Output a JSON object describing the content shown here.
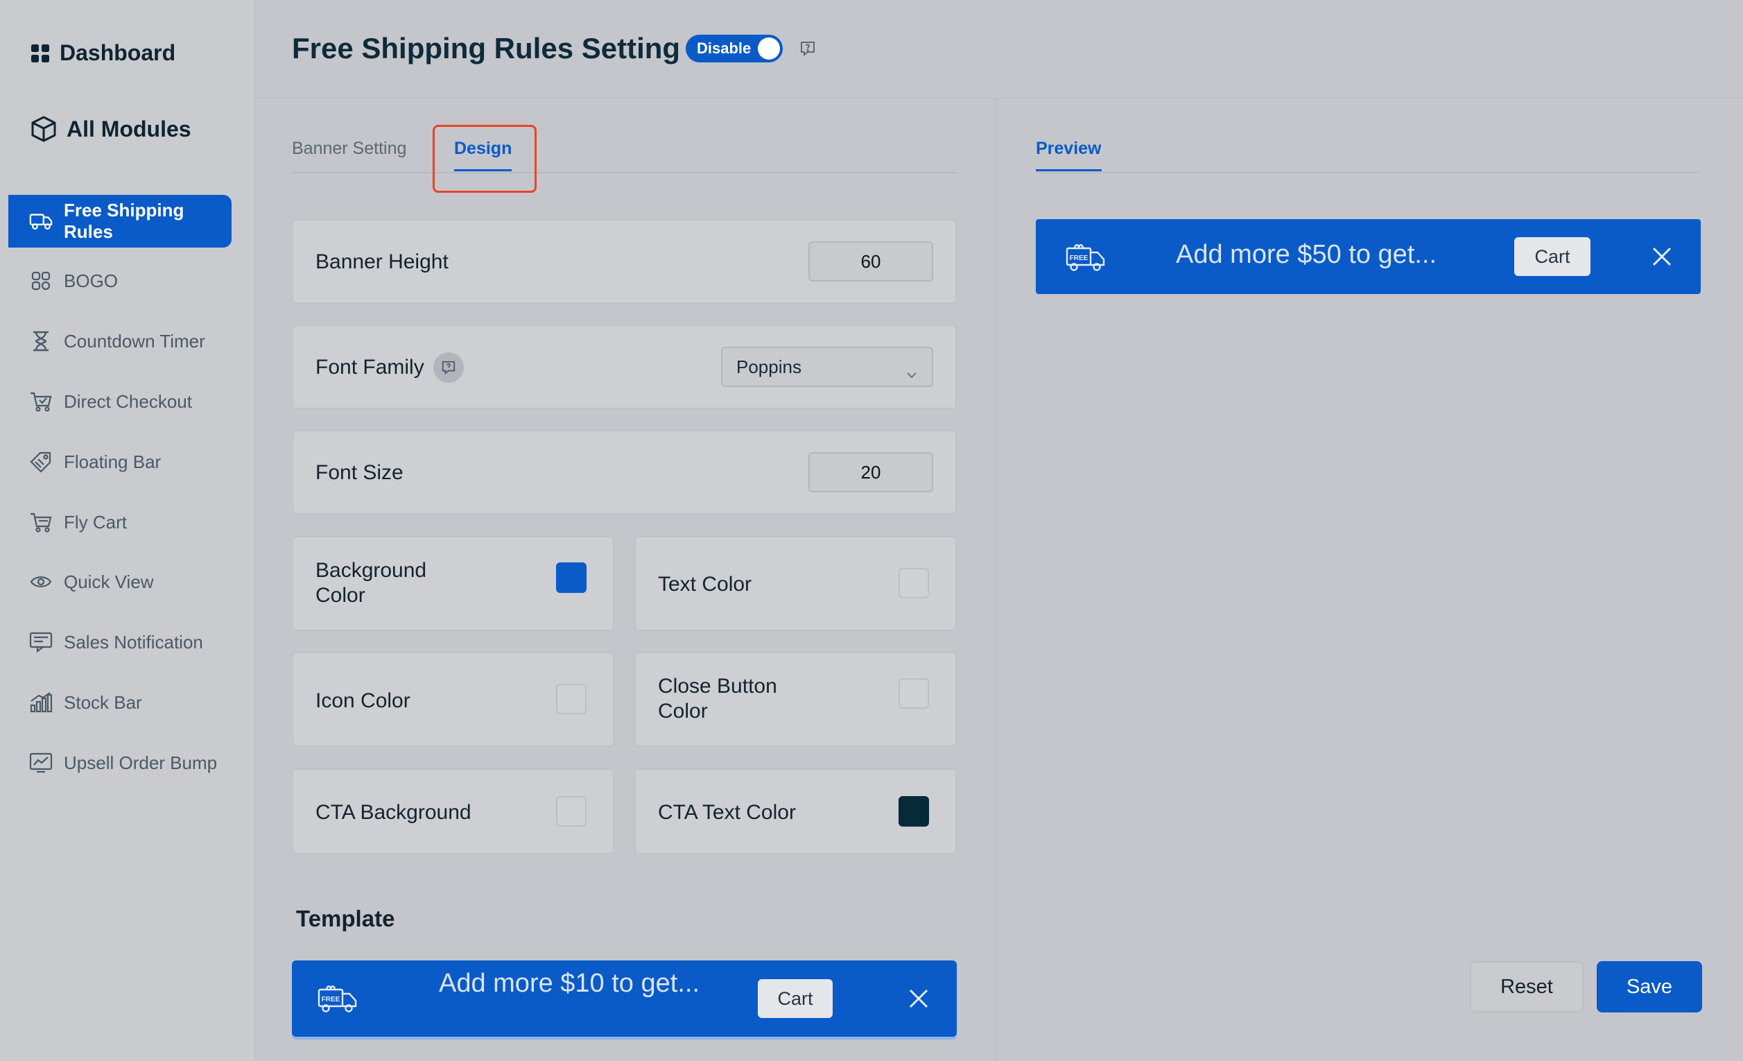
{
  "sidebar": {
    "dashboard": "Dashboard",
    "all_modules": "All Modules",
    "items": [
      {
        "label": "Free Shipping Rules",
        "icon": "truck-icon"
      },
      {
        "label": "BOGO",
        "icon": "bogo-icon"
      },
      {
        "label": "Countdown Timer",
        "icon": "hourglass-icon"
      },
      {
        "label": "Direct Checkout",
        "icon": "cart-check-icon"
      },
      {
        "label": "Floating Bar",
        "icon": "tag-icon"
      },
      {
        "label": "Fly Cart",
        "icon": "cart-icon"
      },
      {
        "label": "Quick View",
        "icon": "eye-icon"
      },
      {
        "label": "Sales Notification",
        "icon": "notification-icon"
      },
      {
        "label": "Stock Bar",
        "icon": "bar-chart-icon"
      },
      {
        "label": "Upsell Order Bump",
        "icon": "chart-line-icon"
      }
    ]
  },
  "header": {
    "title": "Free Shipping Rules Setting",
    "toggle_label": "Disable"
  },
  "tabs": {
    "banner_setting": "Banner Setting",
    "design": "Design"
  },
  "form": {
    "banner_height_label": "Banner Height",
    "banner_height_value": "60",
    "font_family_label": "Font Family",
    "font_family_value": "Poppins",
    "font_size_label": "Font Size",
    "font_size_value": "20",
    "background_color_label": "Background Color",
    "text_color_label": "Text Color",
    "icon_color_label": "Icon Color",
    "close_button_color_label": "Close Button Color",
    "cta_background_label": "CTA Background",
    "cta_text_color_label": "CTA Text Color",
    "background_color": "#0a5ac8",
    "cta_text_color": "#062a3a"
  },
  "template": {
    "title": "Template",
    "text": "Add more $10 to get...",
    "cta": "Cart",
    "badge": "FREE"
  },
  "preview": {
    "tab": "Preview",
    "text": "Add more $50 to get...",
    "cta": "Cart",
    "badge": "FREE"
  },
  "actions": {
    "reset": "Reset",
    "save": "Save"
  }
}
